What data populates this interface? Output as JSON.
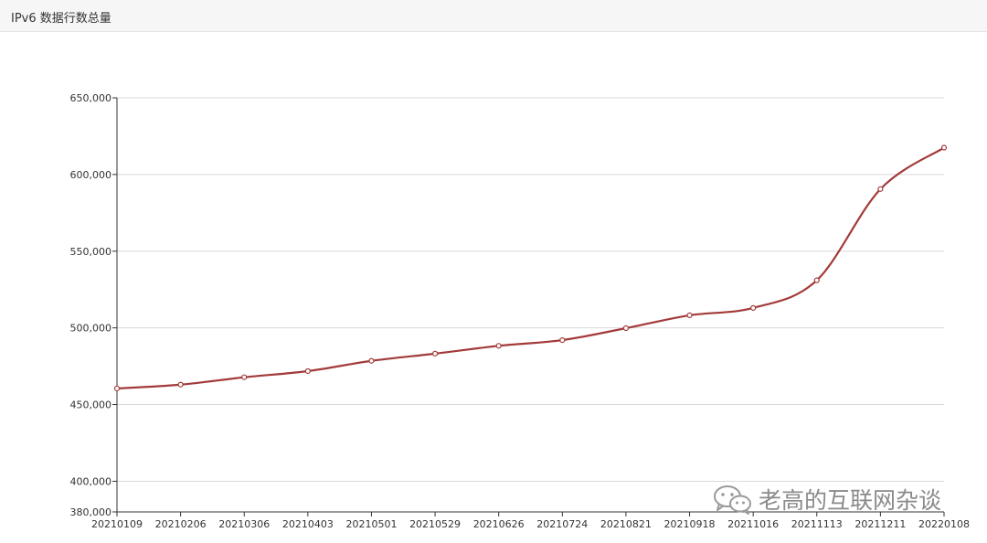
{
  "header": {
    "title": "IPv6 数据行数总量"
  },
  "watermark": {
    "text": "老高的互联网杂谈"
  },
  "colors": {
    "line": "#a33a3a",
    "grid": "#d9d9d9",
    "axis": "#333333",
    "header_bg": "#f6f6f6"
  },
  "chart_data": {
    "type": "line",
    "title": "",
    "xlabel": "",
    "ylabel": "",
    "ylim": [
      380000,
      650000
    ],
    "ytick_values": [
      380000,
      400000,
      450000,
      500000,
      550000,
      600000,
      650000
    ],
    "ytick_labels": [
      "380,000",
      "400,000",
      "450,000",
      "500,000",
      "550,000",
      "600,000",
      "650,000"
    ],
    "grid": "horizontal",
    "categories": [
      "20210109",
      "20210206",
      "20210306",
      "20210403",
      "20210501",
      "20210529",
      "20210626",
      "20210724",
      "20210821",
      "20210918",
      "20211016",
      "20211113",
      "20211211",
      "20220108"
    ],
    "series": [
      {
        "values": [
          460500,
          463000,
          467800,
          471800,
          478500,
          483200,
          488300,
          492000,
          499800,
          508200,
          513000,
          531000,
          590500,
          617500
        ]
      }
    ]
  }
}
